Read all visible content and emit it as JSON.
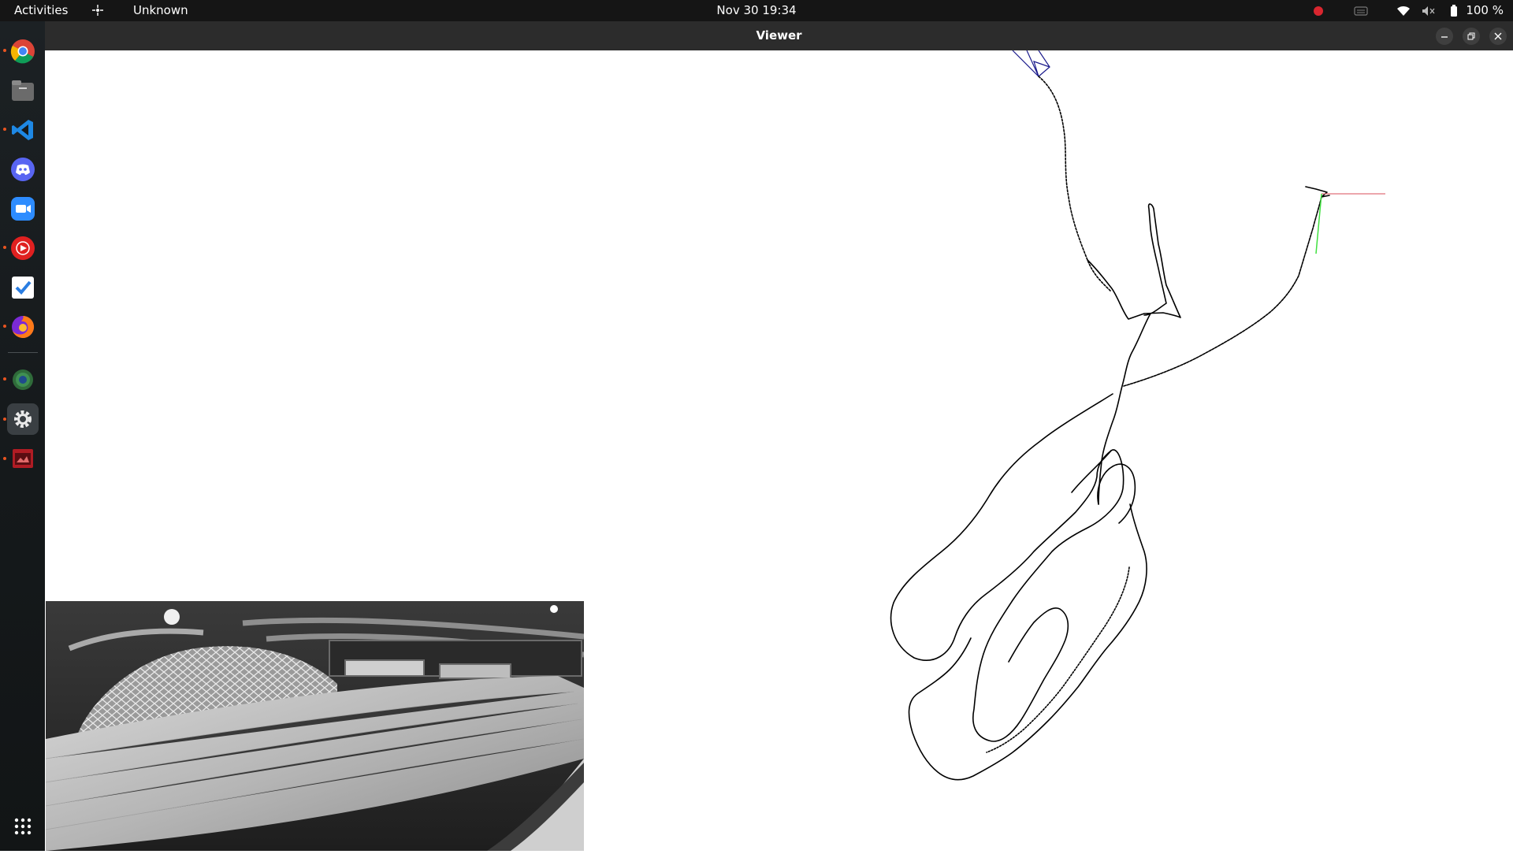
{
  "topbar": {
    "activities": "Activities",
    "app_indicator": "Unknown",
    "clock": "Nov 30  19:34",
    "battery_label": "100 %",
    "status_icons": [
      "record-icon",
      "keyboard-icon",
      "wifi-icon",
      "volume-muted-icon",
      "battery-icon"
    ]
  },
  "dock": {
    "apps": [
      "chrome-icon",
      "files-icon",
      "vscode-icon",
      "discord-icon",
      "zoom-icon",
      "youtube-music-icon",
      "tasks-icon",
      "firefox-icon",
      "photo-viewer-icon",
      "settings-icon",
      "viewer-app-icon"
    ],
    "show_apps": "app-grid-icon"
  },
  "window": {
    "title": "Viewer",
    "controls": [
      "minimize-icon",
      "restore-icon",
      "close-icon"
    ]
  },
  "colors": {
    "topbar": "#151515",
    "dock": "#1c2124",
    "header": "#2c2c2c",
    "trajectory": "#000000",
    "camera_frustum": "#1a1a8c",
    "axis_x": "#e0707a",
    "axis_y": "#40e040"
  }
}
